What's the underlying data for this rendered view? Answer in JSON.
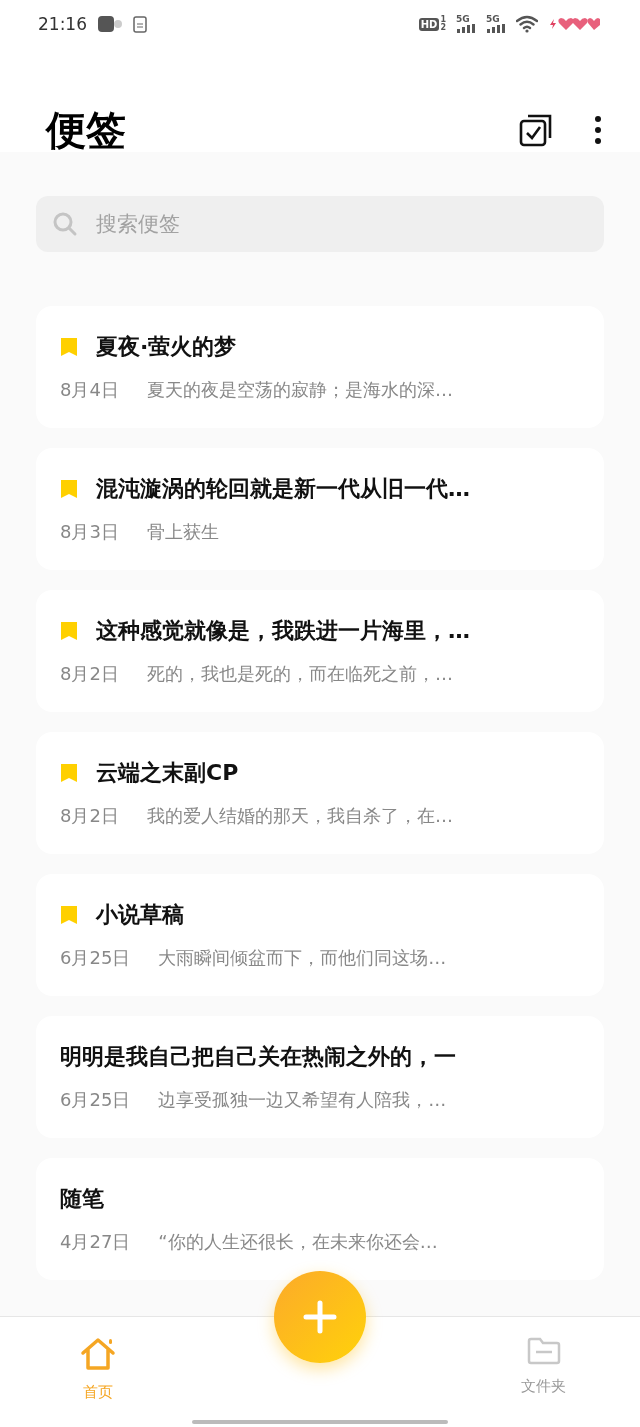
{
  "status_bar": {
    "time": "21:16",
    "hd_label": "HD",
    "sim_slots": [
      "1",
      "2"
    ],
    "network_labels": [
      "5G",
      "5G"
    ]
  },
  "header": {
    "title": "便签"
  },
  "search": {
    "placeholder": "搜索便签"
  },
  "notes": [
    {
      "title": "夏夜·萤火的梦",
      "date": "8月4日",
      "preview": "夏天的夜是空荡的寂静；是海水的深…",
      "pinned": true
    },
    {
      "title": "混沌漩涡的轮回就是新一代从旧一代…",
      "date": "8月3日",
      "preview": "骨上获生",
      "pinned": true
    },
    {
      "title": "这种感觉就像是，我跌进一片海里，…",
      "date": "8月2日",
      "preview": "死的，我也是死的，而在临死之前，…",
      "pinned": true
    },
    {
      "title": "云端之末副CP",
      "date": "8月2日",
      "preview": "我的爱人结婚的那天，我自杀了，在…",
      "pinned": true
    },
    {
      "title": "小说草稿",
      "date": "6月25日",
      "preview": "大雨瞬间倾盆而下，而他们同这场…",
      "pinned": true
    },
    {
      "title": "明明是我自己把自己关在热闹之外的，一",
      "date": "6月25日",
      "preview": "边享受孤独一边又希望有人陪我，…",
      "pinned": false
    },
    {
      "title": "随笔",
      "date": "4月27日",
      "preview": "“你的人生还很长，在未来你还会…",
      "pinned": false
    }
  ],
  "bottom_nav": [
    {
      "label": "首页",
      "kind": "home",
      "selected": true
    },
    {
      "label": "文件夹",
      "kind": "folder",
      "selected": false
    }
  ]
}
